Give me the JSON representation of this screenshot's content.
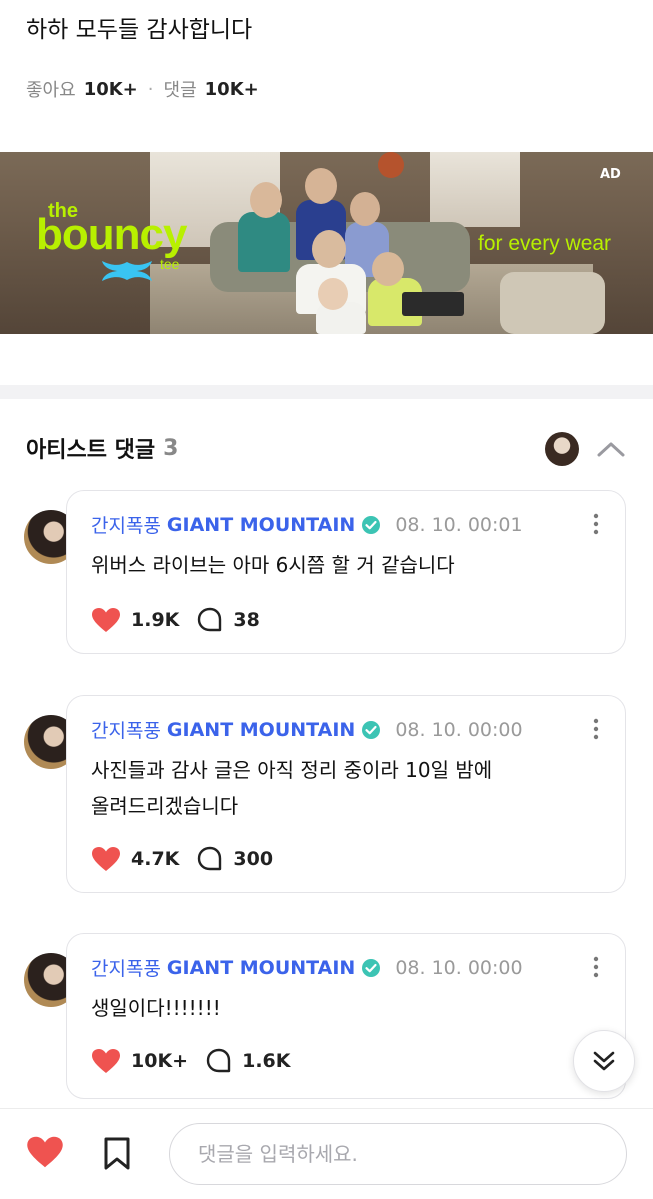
{
  "post": {
    "text": "하하 모두들 감사합니다",
    "likes_label": "좋아요",
    "likes_count": "10K+",
    "separator": "·",
    "comments_label": "댓글",
    "comments_count": "10K+"
  },
  "ad": {
    "logo_the": "the",
    "logo_main": "bouncy",
    "logo_tee": "tee",
    "brand_mark": "UA",
    "tagline": "for every wear",
    "badge": "AD"
  },
  "artist_comments": {
    "title": "아티스트 댓글",
    "count": "3",
    "comments": [
      {
        "author_ko": "간지폭풍",
        "author_en": "GIANT MOUNTAIN",
        "date": "08. 10. 00:01",
        "text": "위버스 라이브는 아마 6시쯤 할 거 같습니다",
        "likes": "1.9K",
        "replies": "38"
      },
      {
        "author_ko": "간지폭풍",
        "author_en": "GIANT MOUNTAIN",
        "date": "08. 10. 00:00",
        "text": "사진들과 감사 글은 아직 정리 중이라 10일 밤에 올려드리겠습니다",
        "likes": "4.7K",
        "replies": "300"
      },
      {
        "author_ko": "간지폭풍",
        "author_en": "GIANT MOUNTAIN",
        "date": "08. 10. 00:00",
        "text": "생일이다!!!!!!!",
        "likes": "10K+",
        "replies": "1.6K"
      }
    ]
  },
  "input": {
    "placeholder": "댓글을 입력하세요."
  },
  "colors": {
    "author": "#3b63ea",
    "heart": "#ef5350",
    "verified": "#3cc4b4",
    "ad_lime": "#b8f000"
  }
}
